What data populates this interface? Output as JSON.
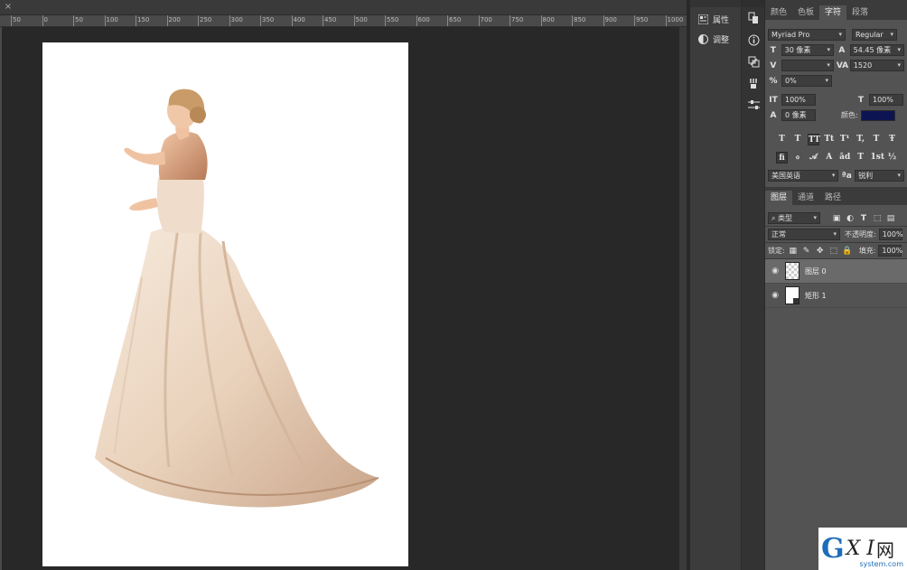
{
  "document": {
    "close_glyph": "×"
  },
  "ruler": {
    "labels": [
      "50",
      "0",
      "50",
      "100",
      "150",
      "200",
      "250",
      "300",
      "350",
      "400",
      "450",
      "500",
      "550",
      "600",
      "650",
      "700",
      "750",
      "800",
      "850",
      "900",
      "950",
      "1000"
    ]
  },
  "dock": {
    "properties_label": "属性",
    "adjust_label": "调整"
  },
  "char_panel": {
    "tabs": [
      "颜色",
      "色板",
      "字符",
      "段落"
    ],
    "active_tab": "字符",
    "font_family": "Myriad Pro",
    "font_style": "Regular",
    "font_size": "30 像素",
    "leading": "54.45 像素",
    "kerning": "",
    "tracking": "1520",
    "tsume": "0%",
    "vscale": "100%",
    "hscale": "100%",
    "baseline": "0 像素",
    "color_label": "颜色:",
    "color_value": "#0d1452",
    "type_buttons": [
      "T",
      "T",
      "TT",
      "Tt",
      "T¹",
      "T,",
      "T",
      "Ŧ"
    ],
    "ot_buttons": [
      "fi",
      "ℴ",
      "𝒜",
      "A",
      "ād",
      "T",
      "1st",
      "½"
    ],
    "language": "美国英语",
    "aa_label": "ªa",
    "antialias": "锐利"
  },
  "layers_panel": {
    "tabs": [
      "图层",
      "通道",
      "路径"
    ],
    "active_tab": "图层",
    "filter_kind": "类型",
    "blend_mode": "正常",
    "opacity_label": "不透明度:",
    "opacity": "100%",
    "lock_label": "锁定:",
    "fill_label": "填充:",
    "fill": "100%",
    "layers": [
      {
        "name": "图层 0",
        "selected": true
      },
      {
        "name": "矩形 1",
        "selected": false
      }
    ]
  },
  "watermark": {
    "brand_g": "G",
    "brand_xi": "X I",
    "brand_net": "网",
    "domain": "system.com"
  }
}
